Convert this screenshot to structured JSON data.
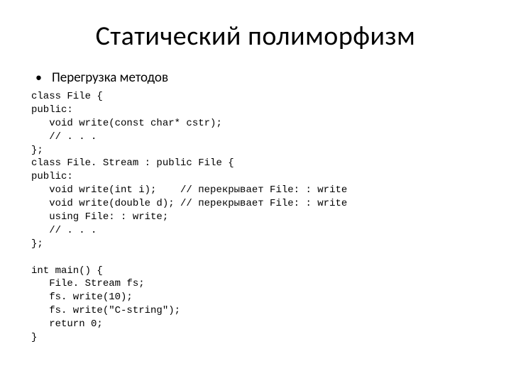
{
  "title": "Статический полиморфизм",
  "bullet": "Перегрузка методов",
  "code_lines": [
    "class File {",
    "public:",
    "   void write(const char* cstr);",
    "   // . . .",
    "};",
    "class File. Stream : public File {",
    "public:",
    "   void write(int i);    // перекрывает File: : write",
    "   void write(double d); // перекрывает File: : write",
    "   using File: : write;",
    "   // . . .",
    "};",
    "",
    "int main() {",
    "   File. Stream fs;",
    "   fs. write(10);",
    "   fs. write(\"C-string\");",
    "   return 0;",
    "}"
  ]
}
